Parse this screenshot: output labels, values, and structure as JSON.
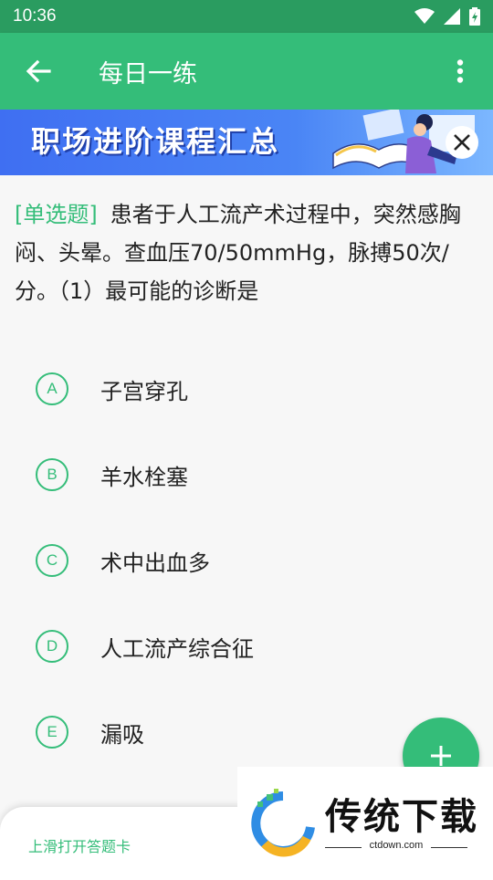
{
  "status_bar": {
    "time": "10:36"
  },
  "app_bar": {
    "title": "每日一练"
  },
  "banner": {
    "text": "职场进阶课程汇总"
  },
  "question": {
    "type": "[单选题]",
    "text": "患者于人工流产术过程中，突然感胸闷、头晕。查血压70/50mmHg，脉搏50次/分。（1）最可能的诊断是"
  },
  "options": [
    {
      "letter": "A",
      "text": "子宫穿孔"
    },
    {
      "letter": "B",
      "text": "羊水栓塞"
    },
    {
      "letter": "C",
      "text": "术中出血多"
    },
    {
      "letter": "D",
      "text": "人工流产综合征"
    },
    {
      "letter": "E",
      "text": "漏吸"
    }
  ],
  "bottom_sheet": {
    "hint": "上滑打开答题卡"
  },
  "watermark": {
    "text": "传统下载",
    "sub": "ctdown.com"
  },
  "colors": {
    "accent": "#34bd79",
    "status_bar": "#2a9c60"
  }
}
